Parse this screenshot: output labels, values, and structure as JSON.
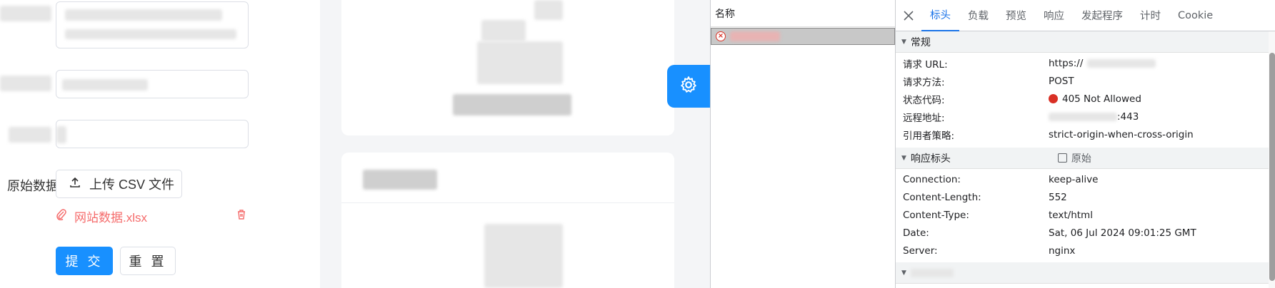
{
  "form": {
    "raw_data_label": "原始数据",
    "upload_button": "上传 CSV 文件",
    "file_name": "网站数据.xlsx",
    "submit_button": "提 交",
    "reset_button": "重 置"
  },
  "devtools": {
    "list_header": "名称",
    "tabs": [
      "标头",
      "负载",
      "预览",
      "响应",
      "发起程序",
      "计时",
      "Cookie"
    ],
    "general": {
      "title": "常规",
      "rows": [
        {
          "k": "请求 URL:",
          "v": "https://"
        },
        {
          "k": "请求方法:",
          "v": "POST"
        },
        {
          "k": "状态代码:",
          "v": "405 Not Allowed"
        },
        {
          "k": "远程地址:",
          "v": ":443"
        },
        {
          "k": "引用者策略:",
          "v": "strict-origin-when-cross-origin"
        }
      ]
    },
    "response_headers": {
      "title": "响应标头",
      "raw_label": "原始",
      "rows": [
        {
          "k": "Connection:",
          "v": "keep-alive"
        },
        {
          "k": "Content-Length:",
          "v": "552"
        },
        {
          "k": "Content-Type:",
          "v": "text/html"
        },
        {
          "k": "Date:",
          "v": "Sat, 06 Jul 2024 09:01:25 GMT"
        },
        {
          "k": "Server:",
          "v": "nginx"
        }
      ]
    },
    "status_color": "#d93025",
    "accent": "#1a73e8"
  },
  "colors": {
    "primary": "#1890ff",
    "danger": "#f56c6c"
  }
}
